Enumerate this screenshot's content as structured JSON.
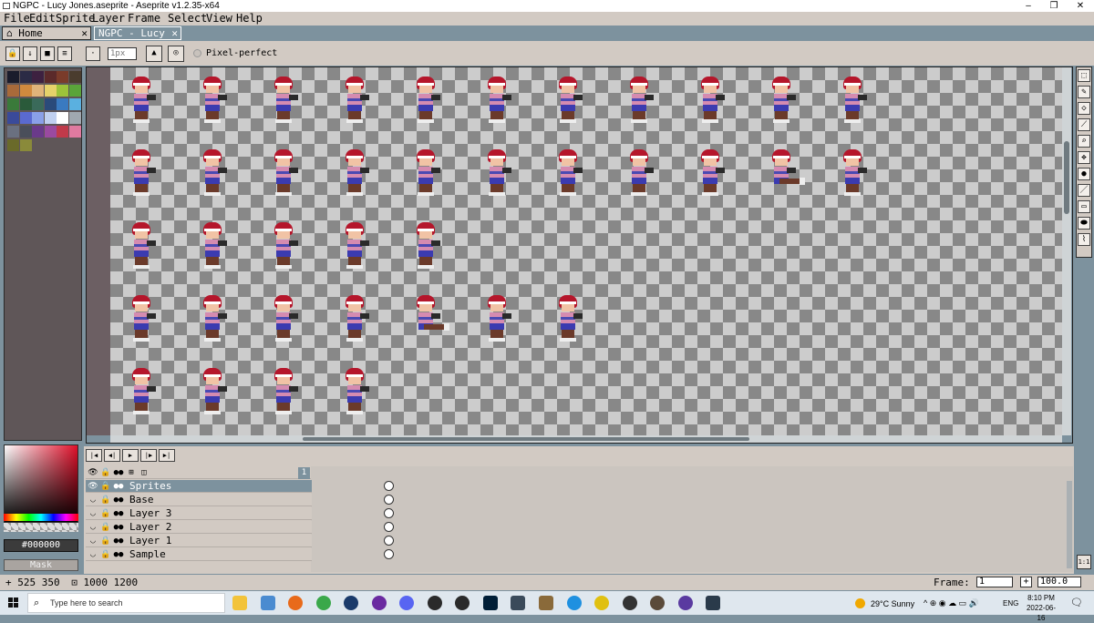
{
  "window": {
    "title": "NGPC - Lucy Jones.aseprite - Aseprite v1.2.35-x64",
    "minimize": "–",
    "maximize": "❐",
    "close": "✕"
  },
  "menubar": [
    "File",
    "Edit",
    "Sprite",
    "Layer",
    "Frame",
    "Select",
    "View",
    "Help"
  ],
  "tabs": {
    "home": {
      "label": "Home",
      "close": "✕"
    },
    "doc": {
      "label": "NGPC - Lucy Jc",
      "close": "✕"
    }
  },
  "context_bar": {
    "brush_size": "1px",
    "pixel_perfect": "Pixel-perfect"
  },
  "palette": {
    "colors": [
      "#1a1c2c",
      "#2b2b45",
      "#3d2140",
      "#5b2a2a",
      "#7a3b2a",
      "#4a3c2e",
      "#a86a3a",
      "#d08a3e",
      "#e0b47a",
      "#e6d26a",
      "#9cc23a",
      "#5aa43a",
      "#3a7a3a",
      "#2a5a3a",
      "#3a6a5a",
      "#2a4a7a",
      "#3a7ac0",
      "#5ab0e0",
      "#3a4a9a",
      "#5a6ad0",
      "#8aa0e8",
      "#c0d0f0",
      "#ffffff",
      "#a0a8b0",
      "#6a7080",
      "#4a4e5a",
      "#6a3a8a",
      "#9a4aa0",
      "#c03a4a",
      "#e07aa0",
      "#6a6a2a",
      "#8a8a3a"
    ]
  },
  "color_picker": {
    "hex": "#000000",
    "mask_label": "Mask",
    "accent": "#e0102a"
  },
  "layers": {
    "frame_number": "1",
    "rows": [
      {
        "name": "Sprites",
        "selected": true
      },
      {
        "name": "Base",
        "selected": false
      },
      {
        "name": "Layer 3",
        "selected": false
      },
      {
        "name": "Layer 2",
        "selected": false
      },
      {
        "name": "Layer 1",
        "selected": false
      },
      {
        "name": "Sample",
        "selected": false
      }
    ]
  },
  "status_bar": {
    "cursor": "+ 525 350",
    "size": "1000 1200",
    "frame_label": "Frame:",
    "frame_value": "1",
    "plus": "+",
    "zoom": "100.0"
  },
  "taskbar": {
    "search_placeholder": "Type here to search",
    "weather": "29°C  Sunny",
    "language": "ENG",
    "time": "8:10 PM",
    "date": "2022-06-16"
  }
}
